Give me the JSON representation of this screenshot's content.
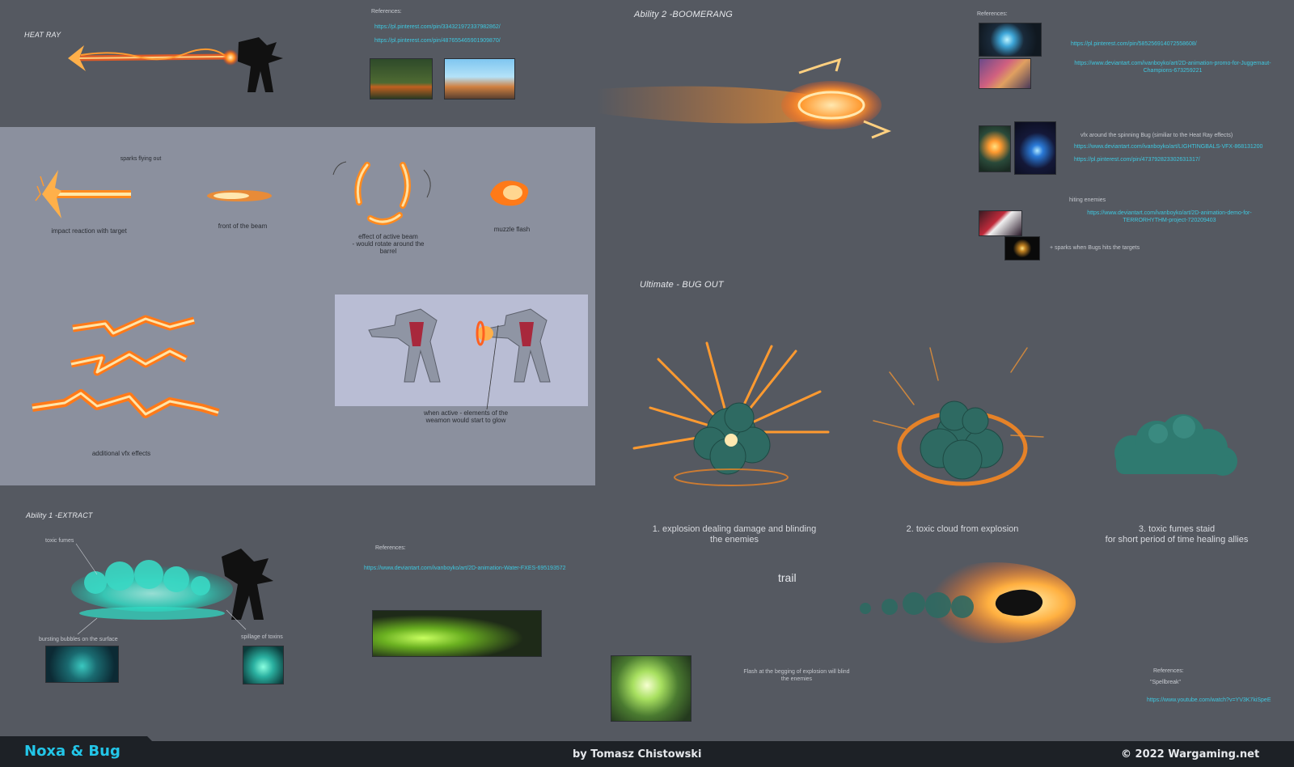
{
  "heat_ray": {
    "title": "HEAT RAY",
    "references_label": "References:",
    "links": [
      "https://pl.pinterest.com/pin/334321972337982862/",
      "https://pl.pinterest.com/pin/487655465901909870/"
    ],
    "notes": {
      "sparks": "sparks flying out",
      "impact": "impact reaction with target",
      "front": "front of the beam",
      "active": "effect of active beam\n- would rotate around the\nbarrel",
      "muzzle": "muzzle flash",
      "additional": "additional vfx effects",
      "glow": "when active - elements of the\nweamon would start to glow"
    }
  },
  "ability2": {
    "title": "Ability 2 -BOOMERANG",
    "references_label": "References:",
    "link1": "https://pl.pinterest.com/pin/585256914072558608/",
    "link2": "https://www.deviantart.com/ivanboyko/art/2D-animation-promo-for-Juggernaut-Champions-673259221",
    "note_vfx": "vfx around the spinning Bug (similiar to the Heat Ray effects)",
    "link3": "https://www.deviantart.com/ivanboyko/art/LIGHTINGBALS-VFX-868131200",
    "link4": "https://pl.pinterest.com/pin/473792823302631317/",
    "note_hit": "hiting enemies",
    "link5": "https://www.deviantart.com/ivanboyko/art/2D-animation-demo-for-TERRORHYTHM-project-720209403",
    "note_sparks": "+ sparks when Bugs hits the targets"
  },
  "ultimate": {
    "title": "Ultimate - BUG OUT",
    "captions": [
      "1. explosion dealing damage and blinding\nthe enemies",
      "2. toxic cloud from explosion",
      "3. toxic fumes staid\nfor short period of time healing allies"
    ],
    "trail_label": "trail",
    "flash_note": "Flash at the begging of explosion will blind\nthe enemies",
    "references_label": "References:",
    "ref_name": "\"Spellbreak\"",
    "ref_link": "https://www.youtube.com/watch?v=YV3K7kiSpeE"
  },
  "ability1": {
    "title": "Ability 1 -EXTRACT",
    "note_fumes": "toxic fumes",
    "note_bubbles": "bursting bubbles on the surface",
    "note_spillage": "spillage of toxins",
    "references_label": "References:",
    "link": "https://www.deviantart.com/ivanboyko/art/2D-animation-Water-FXES-695193572"
  },
  "footer": {
    "title": "Noxa & Bug",
    "author": "by Tomasz Chistowski",
    "copyright": "© 2022 Wargaming.net"
  },
  "colors": {
    "background": "#555961",
    "panel": "#8b909e",
    "fire": "#ff8a1e",
    "toxic": "#2fe0c8",
    "link": "#3ec8e0",
    "footer_title": "#23c6e8"
  }
}
